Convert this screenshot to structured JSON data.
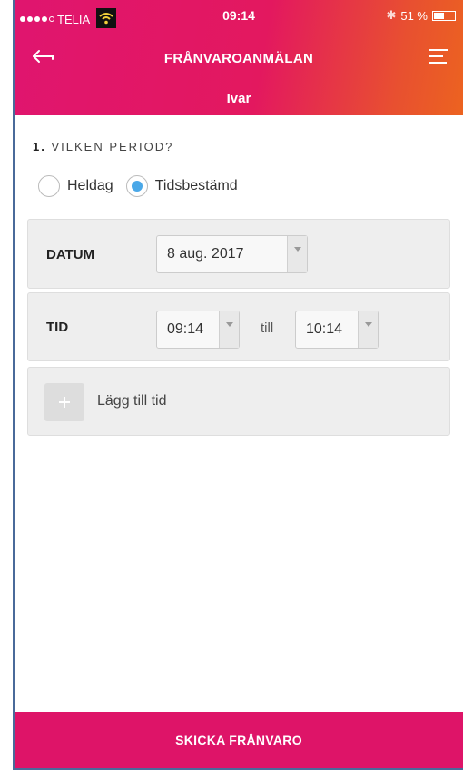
{
  "status": {
    "carrier": "TELIA",
    "time": "09:14",
    "battery_pct": "51 %",
    "battery_level": 0.51
  },
  "nav": {
    "title": "FRÅNVAROANMÄLAN",
    "subtitle": "Ivar"
  },
  "section": {
    "number": "1.",
    "title": "VILKEN PERIOD?"
  },
  "period_options": [
    {
      "label": "Heldag",
      "selected": false
    },
    {
      "label": "Tidsbestämd",
      "selected": true
    }
  ],
  "date_row": {
    "label": "DATUM",
    "value": "8 aug. 2017"
  },
  "time_row": {
    "label": "TID",
    "from": "09:14",
    "separator": "till",
    "to": "10:14"
  },
  "add_time": {
    "label": "Lägg till tid"
  },
  "footer": {
    "submit_label": "SKICKA FRÅNVARO"
  },
  "colors": {
    "header_pink": "#e0156f",
    "header_orange": "#ec6320",
    "footer": "#de1468",
    "radio_selected": "#4aa8e8"
  }
}
